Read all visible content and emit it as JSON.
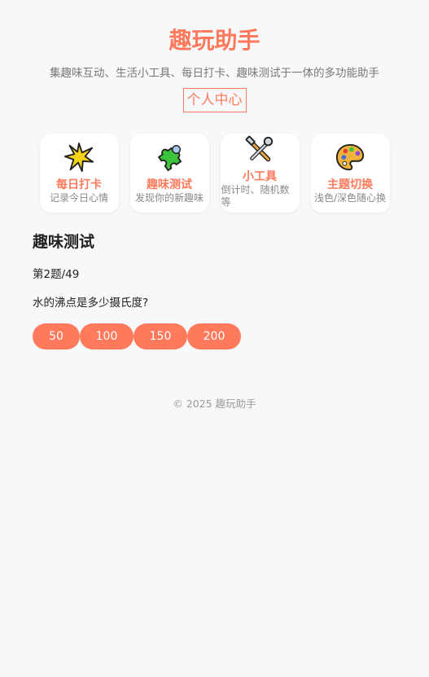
{
  "header": {
    "title": "趣玩助手",
    "subtitle": "集趣味互动、生活小工具、每日打卡、趣味测试于一体的多功能助手",
    "profile_link": "个人中心"
  },
  "cards": [
    {
      "icon": "star-burst-icon",
      "title": "每日打卡",
      "desc": "记录今日心情"
    },
    {
      "icon": "puzzle-piece-icon",
      "title": "趣味测试",
      "desc": "发现你的新趣味"
    },
    {
      "icon": "tools-icon",
      "title": "小工具",
      "desc": "倒计时、随机数等"
    },
    {
      "icon": "palette-icon",
      "title": "主题切换",
      "desc": "浅色/深色随心换"
    }
  ],
  "quiz": {
    "section_title": "趣味测试",
    "progress": "第2题/49",
    "question": "水的沸点是多少摄氏度?",
    "options": [
      "50",
      "100",
      "150",
      "200"
    ]
  },
  "footer": {
    "copyright": "© 2025 趣玩助手"
  },
  "colors": {
    "accent": "#ff7a5c",
    "background": "#f7f8fa",
    "card_bg": "#ffffff"
  }
}
